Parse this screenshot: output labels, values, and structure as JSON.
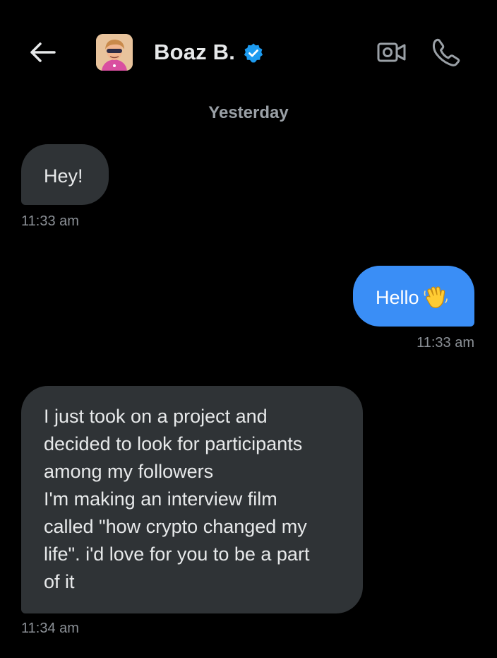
{
  "header": {
    "contact_name": "Boaz B.",
    "verified": true,
    "icons": {
      "back": "arrow-left-icon",
      "verified": "verified-badge-icon",
      "video": "video-call-icon",
      "phone": "phone-call-icon"
    }
  },
  "conversation": {
    "date_separator": "Yesterday",
    "messages": [
      {
        "direction": "incoming",
        "text": "Hey!",
        "time": "11:33 am"
      },
      {
        "direction": "outgoing",
        "text": "Hello",
        "emoji": "waving-hand-emoji",
        "time": "11:33 am"
      },
      {
        "direction": "incoming",
        "text": "I just took on a project and\ndecided to look for participants\namong my followers\nI'm making an interview film\ncalled \"how crypto changed my\nlife\". i'd love for you to be a part\nof it",
        "time": "11:34 am"
      }
    ]
  },
  "colors": {
    "background": "#000000",
    "incoming_bubble": "#2f3336",
    "outgoing_bubble": "#3a8ef6",
    "verified": "#1d9bf0",
    "timestamp": "#8b9096"
  }
}
